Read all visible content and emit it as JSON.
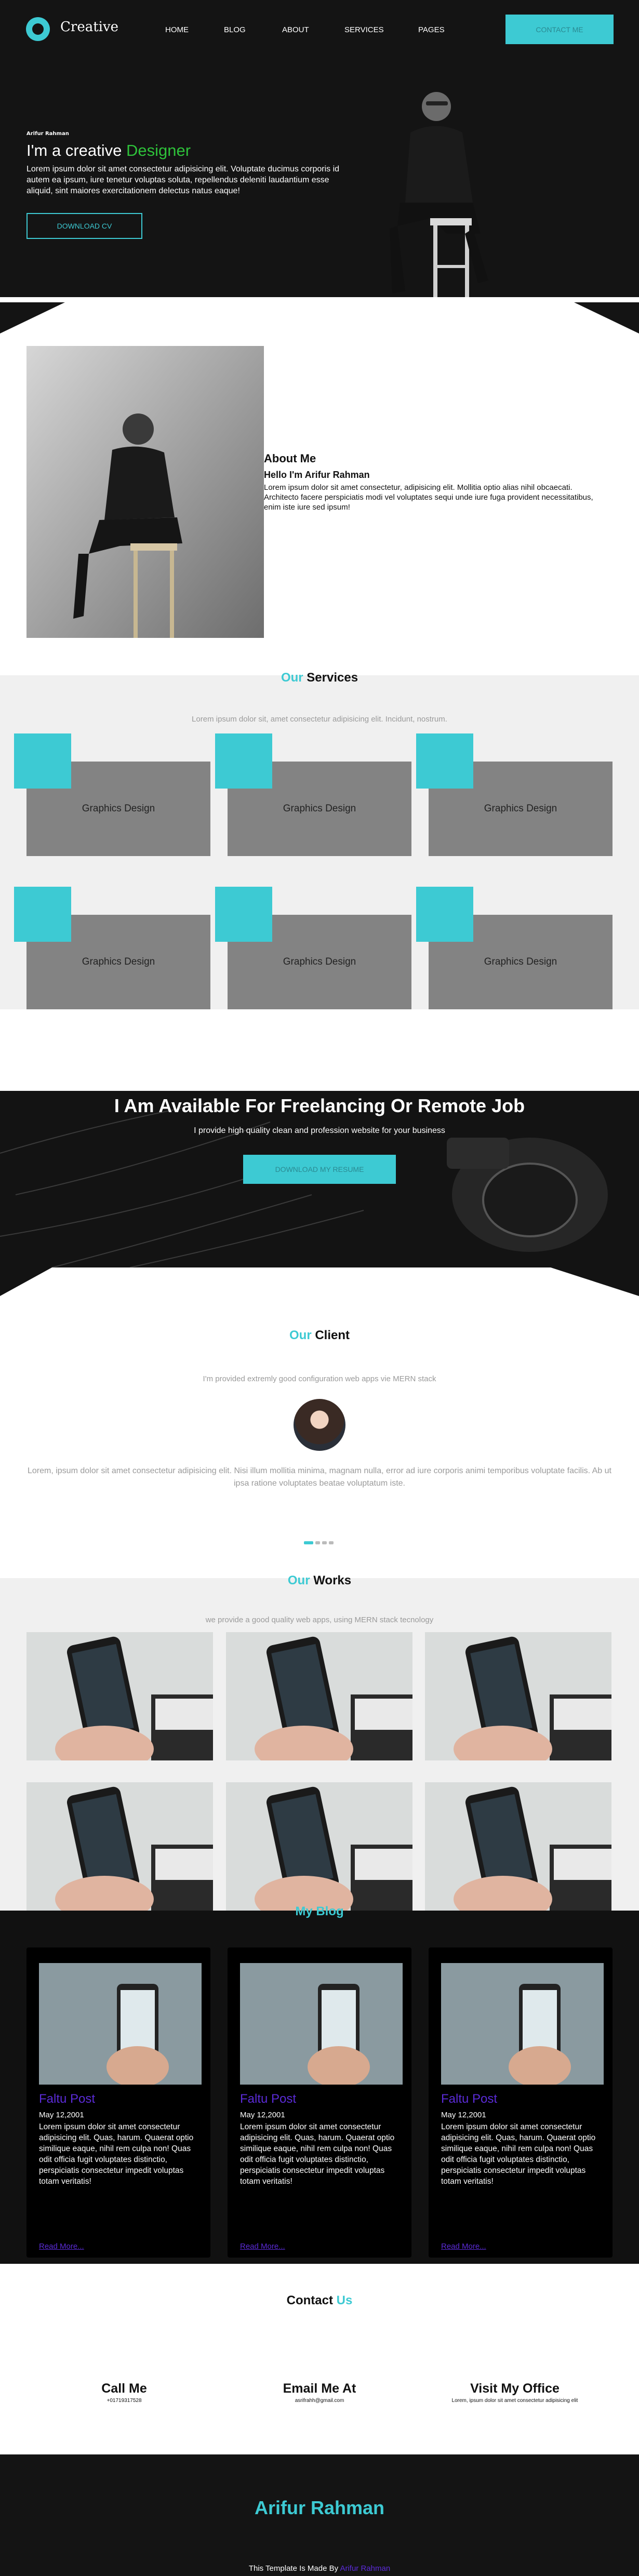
{
  "colors": {
    "accent": "#3dcad3",
    "highlight": "#2ec23a",
    "link": "#5b2bd8",
    "dark": "#141414"
  },
  "header": {
    "logo_text": "Creative",
    "nav": [
      "HOME",
      "BLOG",
      "ABOUT",
      "SERVICES",
      "PAGES"
    ],
    "contact_button": "CONTACT ME"
  },
  "hero": {
    "name": "Arifur Rahman",
    "headline_prefix": "I'm a creative",
    "headline_highlight": "Designer",
    "text": "Lorem ipsum dolor sit amet consectetur adipisicing elit. Voluptate ducimus corporis id autem ea ipsum, iure tenetur voluptas soluta, repellendus deleniti laudantium esse aliquid, sint maiores exercitationem delectus natus eaque!",
    "button": "DOWNLOAD CV"
  },
  "about": {
    "title": "About Me",
    "hello": "Hello I'm Arifur Rahman",
    "text": "Lorem ipsum dolor sit amet consectetur, adipisicing elit. Mollitia optio alias nihil obcaecati. Architecto facere perspiciatis modi vel voluptates sequi unde iure fuga provident necessitatibus, enim iste iure sed ipsum!"
  },
  "services": {
    "title_accent": "Our",
    "title": "Services",
    "subtitle": "Lorem ipsum dolor sit, amet consectetur adipisicing elit. Incidunt, nostrum.",
    "items": [
      "Graphics Design",
      "Graphics Design",
      "Graphics Design",
      "Graphics Design",
      "Graphics Design",
      "Graphics Design"
    ]
  },
  "freelance": {
    "title": "I Am Available For Freelancing Or Remote Job",
    "subtitle": "I provide high quality clean and profession website for your business",
    "button": "DOWNLOAD MY RESUME"
  },
  "client": {
    "title_accent": "Our",
    "title": "Client",
    "subtitle": "I'm provided extremly good configuration web apps vie MERN stack",
    "testimonial": "Lorem, ipsum dolor sit amet consectetur adipisicing elit. Nisi illum mollitia minima, magnam nulla, error ad iure corporis animi temporibus voluptate facilis. Ab ut ipsa ratione voluptates beatae voluptatum iste.",
    "dots": 4,
    "active_dot": 0
  },
  "works": {
    "title_accent": "Our",
    "title": "Works",
    "subtitle": "we provide a good quality web apps, using MERN stack tecnology",
    "count": 6
  },
  "blog": {
    "title": "My Blog",
    "posts": [
      {
        "title": "Faltu Post",
        "date": "May 12,2001",
        "text": "Lorem ipsum dolor sit amet consectetur adipisicing elit. Quas, harum. Quaerat optio similique eaque, nihil rem culpa non! Quas odit officia fugit voluptates distinctio, perspiciatis consectetur impedit voluptas totam veritatis!",
        "more": "Read More..."
      },
      {
        "title": "Faltu Post",
        "date": "May 12,2001",
        "text": "Lorem ipsum dolor sit amet consectetur adipisicing elit. Quas, harum. Quaerat optio similique eaque, nihil rem culpa non! Quas odit officia fugit voluptates distinctio, perspiciatis consectetur impedit voluptas totam veritatis!",
        "more": "Read More..."
      },
      {
        "title": "Faltu Post",
        "date": "May 12,2001",
        "text": "Lorem ipsum dolor sit amet consectetur adipisicing elit. Quas, harum. Quaerat optio similique eaque, nihil rem culpa non! Quas odit officia fugit voluptates distinctio, perspiciatis consectetur impedit voluptas totam veritatis!",
        "more": "Read More..."
      }
    ]
  },
  "contact": {
    "title": "Contact",
    "title_accent": "Us",
    "items": [
      {
        "heading": "Call Me",
        "value": "+01719317528"
      },
      {
        "heading": "Email Me At",
        "value": "asrifrahh@gmail.com"
      },
      {
        "heading": "Visit My Office",
        "value": "Lorem, ipsum dolor sit amet consectetur adipisicing elit"
      }
    ]
  },
  "footer": {
    "name": "Arifur Rahman",
    "made_by_prefix": "This Template Is Made By",
    "made_by_name": "Arifur Rahman"
  }
}
